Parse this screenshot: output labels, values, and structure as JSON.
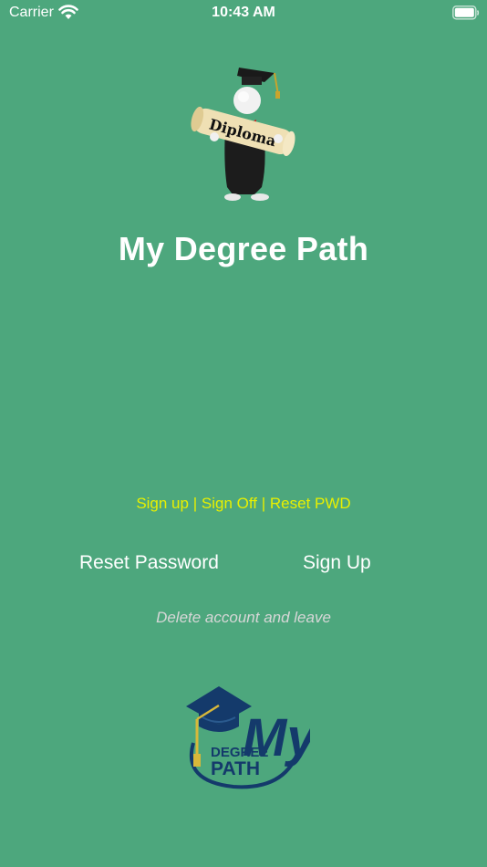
{
  "status_bar": {
    "carrier": "Carrier",
    "time": "10:43 AM",
    "icons": [
      "wifi-icon",
      "battery-icon"
    ]
  },
  "hero": {
    "image": "graduate-with-diploma-illustration",
    "diploma_text": "Diploma"
  },
  "app_title": "My Degree Path",
  "nav_links": {
    "sign_up": "Sign up",
    "separator": "|",
    "sign_off": "Sign Off",
    "reset_pwd": "Reset PWD"
  },
  "buttons": {
    "reset_password": "Reset Password",
    "sign_up": "Sign Up"
  },
  "delete_account": "Delete account and leave",
  "logo": {
    "my": "My",
    "degree": "DEGREE",
    "path": "PATH"
  },
  "colors": {
    "background": "#4da77d",
    "link_yellow": "#e8f000",
    "logo_navy": "#143a6b",
    "tassel_gold": "#d8b83a"
  }
}
